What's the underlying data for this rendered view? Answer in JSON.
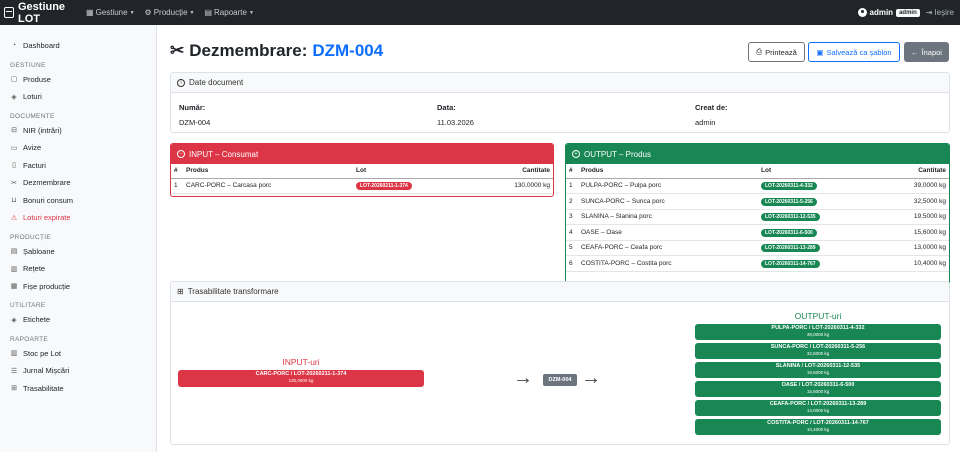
{
  "app": {
    "brand": "Gestiune LOT"
  },
  "nav": {
    "menu": [
      {
        "label": "Gestiune"
      },
      {
        "label": "Producție"
      },
      {
        "label": "Rapoarte"
      }
    ],
    "user": "admin",
    "role_badge": "admin",
    "logout": "Ieșire"
  },
  "sidebar": {
    "dashboard": "Dashboard",
    "sections": [
      {
        "title": "GESTIUNE",
        "items": [
          {
            "label": "Produse"
          },
          {
            "label": "Loturi"
          }
        ]
      },
      {
        "title": "DOCUMENTE",
        "items": [
          {
            "label": "NIR (intrări)"
          },
          {
            "label": "Avize"
          },
          {
            "label": "Facturi"
          },
          {
            "label": "Dezmembrare"
          },
          {
            "label": "Bonuri consum"
          },
          {
            "label": "Loturi expirate"
          }
        ]
      },
      {
        "title": "PRODUCȚIE",
        "items": [
          {
            "label": "Șabloane"
          },
          {
            "label": "Rețete"
          },
          {
            "label": "Fișe producție"
          }
        ]
      },
      {
        "title": "UTILITARE",
        "items": [
          {
            "label": "Etichete"
          }
        ]
      },
      {
        "title": "RAPOARTE",
        "items": [
          {
            "label": "Stoc pe Lot"
          },
          {
            "label": "Jurnal Mișcări"
          },
          {
            "label": "Trasabilitate"
          }
        ]
      }
    ]
  },
  "page": {
    "title": "Dezmembrare:",
    "doc_number": "DZM-004",
    "buttons": {
      "print": "Printează",
      "save_template": "Salvează ca șablon",
      "back": "Înapoi"
    }
  },
  "doc_card": {
    "header": "Date document",
    "fields": [
      {
        "label": "Număr:",
        "value": "DZM-004"
      },
      {
        "label": "Data:",
        "value": "11.03.2026"
      },
      {
        "label": "Creat de:",
        "value": "admin"
      }
    ]
  },
  "input_card": {
    "header": "INPUT – Consumat",
    "columns": [
      "#",
      "Produs",
      "Lot",
      "Cantitate"
    ],
    "rows": [
      {
        "n": "1",
        "produs": "CARC-PORC – Carcasa porc",
        "lot": "LOT-20260211-1-374",
        "cant": "130,0000 kg"
      }
    ]
  },
  "output_card": {
    "header": "OUTPUT – Produs",
    "columns": [
      "#",
      "Produs",
      "Lot",
      "Cantitate"
    ],
    "rows": [
      {
        "n": "1",
        "produs": "PULPA-PORC – Pulpa porc",
        "lot": "LOT-20260311-4-332",
        "cant": "39,0000 kg"
      },
      {
        "n": "2",
        "produs": "SUNCA-PORC – Sunca porc",
        "lot": "LOT-20260311-5-256",
        "cant": "32,5000 kg"
      },
      {
        "n": "3",
        "produs": "SLANINA – Slanina porc",
        "lot": "LOT-20260311-12-535",
        "cant": "19,5000 kg"
      },
      {
        "n": "4",
        "produs": "OASE – Oase",
        "lot": "LOT-20260311-6-500",
        "cant": "15,6000 kg"
      },
      {
        "n": "5",
        "produs": "CEAFA-PORC – Ceafa porc",
        "lot": "LOT-20260311-13-289",
        "cant": "13,0000 kg"
      },
      {
        "n": "6",
        "produs": "COSTITA-PORC – Costita porc",
        "lot": "LOT-20260311-14-767",
        "cant": "10,4000 kg"
      }
    ]
  },
  "trace": {
    "header": "Trasabilitate transformare",
    "input_title": "INPUT-uri",
    "output_title": "OUTPUT-uri",
    "center": "DZM-004",
    "input_nodes": [
      {
        "label": "CARC-PORC / LOT-20260211-1-374",
        "qty": "130,0000 kg"
      }
    ],
    "output_nodes": [
      {
        "label": "PULPA-PORC / LOT-20260311-4-332",
        "qty": "39,0000 kg"
      },
      {
        "label": "SUNCA-PORC / LOT-20260311-5-256",
        "qty": "32,5000 kg"
      },
      {
        "label": "SLANINA / LOT-20260311-12-535",
        "qty": "19,5000 kg"
      },
      {
        "label": "OASE / LOT-20260311-6-500",
        "qty": "15,6000 kg"
      },
      {
        "label": "CEAFA-PORC / LOT-20260311-13-289",
        "qty": "13,0000 kg"
      },
      {
        "label": "COSTITA-PORC / LOT-20260311-14-767",
        "qty": "10,4000 kg"
      }
    ]
  }
}
